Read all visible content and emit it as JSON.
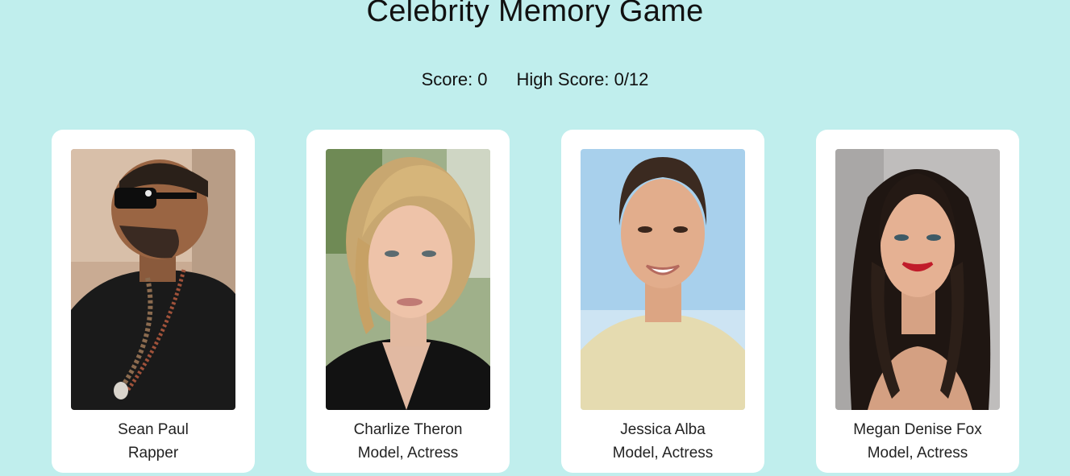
{
  "game": {
    "title": "Celebrity Memory Game"
  },
  "score": {
    "current_label": "Score: 0",
    "high_label": "High Score: 0/12"
  },
  "cards": [
    {
      "name": "Sean Paul",
      "role": "Rapper",
      "icon": "portrait-sean-paul"
    },
    {
      "name": "Charlize Theron",
      "role": "Model, Actress",
      "icon": "portrait-charlize-theron"
    },
    {
      "name": "Jessica Alba",
      "role": "Model, Actress",
      "icon": "portrait-jessica-alba"
    },
    {
      "name": "Megan Denise Fox",
      "role": "Model, Actress",
      "icon": "portrait-megan-fox"
    }
  ],
  "colors": {
    "background": "#c0eeed",
    "card": "#ffffff"
  }
}
